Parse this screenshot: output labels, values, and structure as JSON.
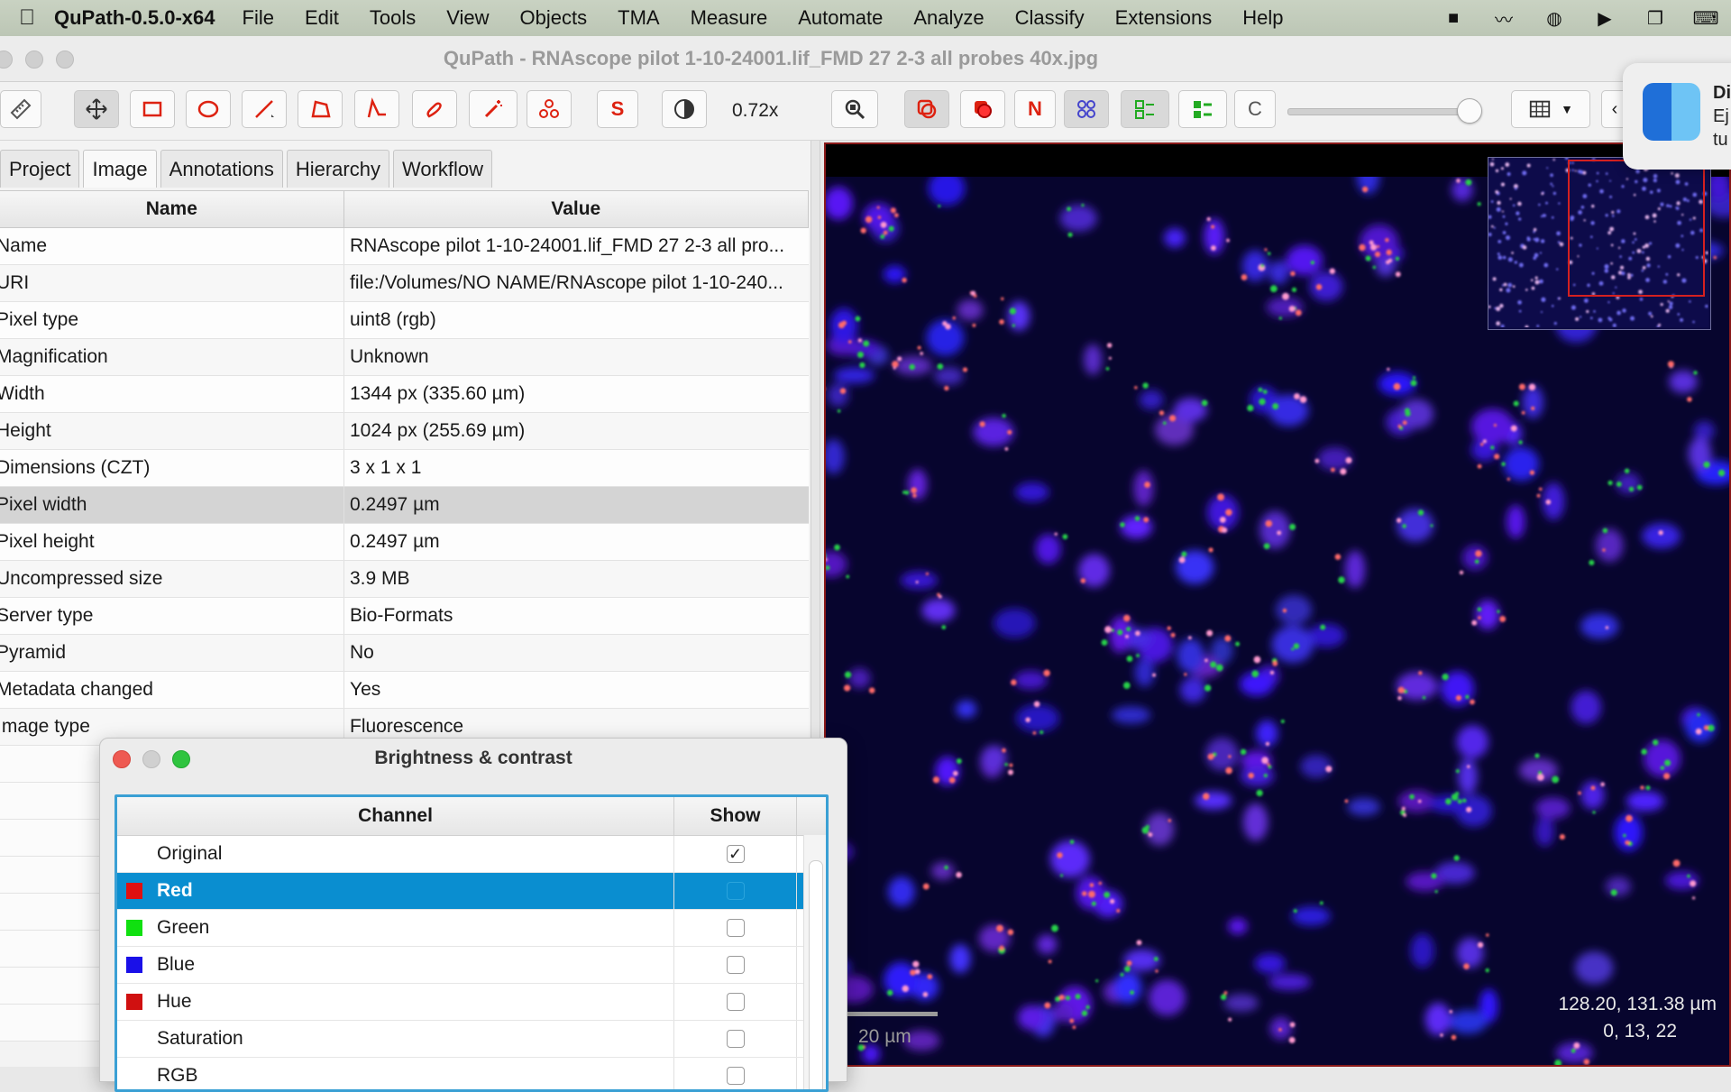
{
  "menubar": {
    "app_name": "QuPath-0.5.0-x64",
    "items": [
      "File",
      "Edit",
      "Tools",
      "View",
      "Objects",
      "TMA",
      "Measure",
      "Automate",
      "Analyze",
      "Classify",
      "Extensions",
      "Help"
    ]
  },
  "window": {
    "title": "QuPath - RNAscope pilot 1-10-24001.lif_FMD 27 2-3 all probes 40x.jpg"
  },
  "toolbar": {
    "zoom": "0.72x",
    "btn_s": "S",
    "btn_n": "N",
    "btn_c": "C",
    "slider_value_fraction": 0.95
  },
  "tabs": [
    "Project",
    "Image",
    "Annotations",
    "Hierarchy",
    "Workflow"
  ],
  "properties": {
    "columns": [
      "Name",
      "Value"
    ],
    "rows": [
      {
        "name": "Name",
        "value": "RNAscope pilot 1-10-24001.lif_FMD 27 2-3 all pro..."
      },
      {
        "name": "URI",
        "value": "file:/Volumes/NO NAME/RNAscope pilot 1-10-240..."
      },
      {
        "name": "Pixel type",
        "value": "uint8 (rgb)"
      },
      {
        "name": "Magnification",
        "value": "Unknown"
      },
      {
        "name": "Width",
        "value": "1344 px (335.60 µm)"
      },
      {
        "name": "Height",
        "value": "1024 px (255.69 µm)"
      },
      {
        "name": "Dimensions (CZT)",
        "value": "3 x 1 x 1"
      },
      {
        "name": "Pixel width",
        "value": "0.2497 µm"
      },
      {
        "name": "Pixel height",
        "value": "0.2497 µm"
      },
      {
        "name": "Uncompressed size",
        "value": "3.9 MB"
      },
      {
        "name": "Server type",
        "value": "Bio-Formats"
      },
      {
        "name": "Pyramid",
        "value": "No"
      },
      {
        "name": "Metadata changed",
        "value": "Yes"
      },
      {
        "name": "Image type",
        "value": "Fluorescence"
      }
    ]
  },
  "viewer": {
    "scale_label": "20 µm",
    "coord_um": "128.20, 131.38 µm",
    "pixel_value": "0, 13, 22"
  },
  "notification": {
    "lines": [
      "Di",
      "Ej",
      "tu"
    ]
  },
  "brightness_contrast": {
    "title": "Brightness & contrast",
    "columns": [
      "Channel",
      "Show"
    ],
    "channels": [
      {
        "name": "Original",
        "color": "",
        "show": true
      },
      {
        "name": "Red",
        "color": "#e01010",
        "show": false
      },
      {
        "name": "Green",
        "color": "#10e010",
        "show": false
      },
      {
        "name": "Blue",
        "color": "#1a10e8",
        "show": false
      },
      {
        "name": "Hue",
        "color": "#d01010",
        "show": false
      },
      {
        "name": "Saturation",
        "color": "",
        "show": false
      },
      {
        "name": "RGB",
        "color": "",
        "show": false
      }
    ],
    "selected": "Red"
  },
  "colors": {
    "accent": "#0a8ed0",
    "viewer_border": "#8a1a1a"
  }
}
